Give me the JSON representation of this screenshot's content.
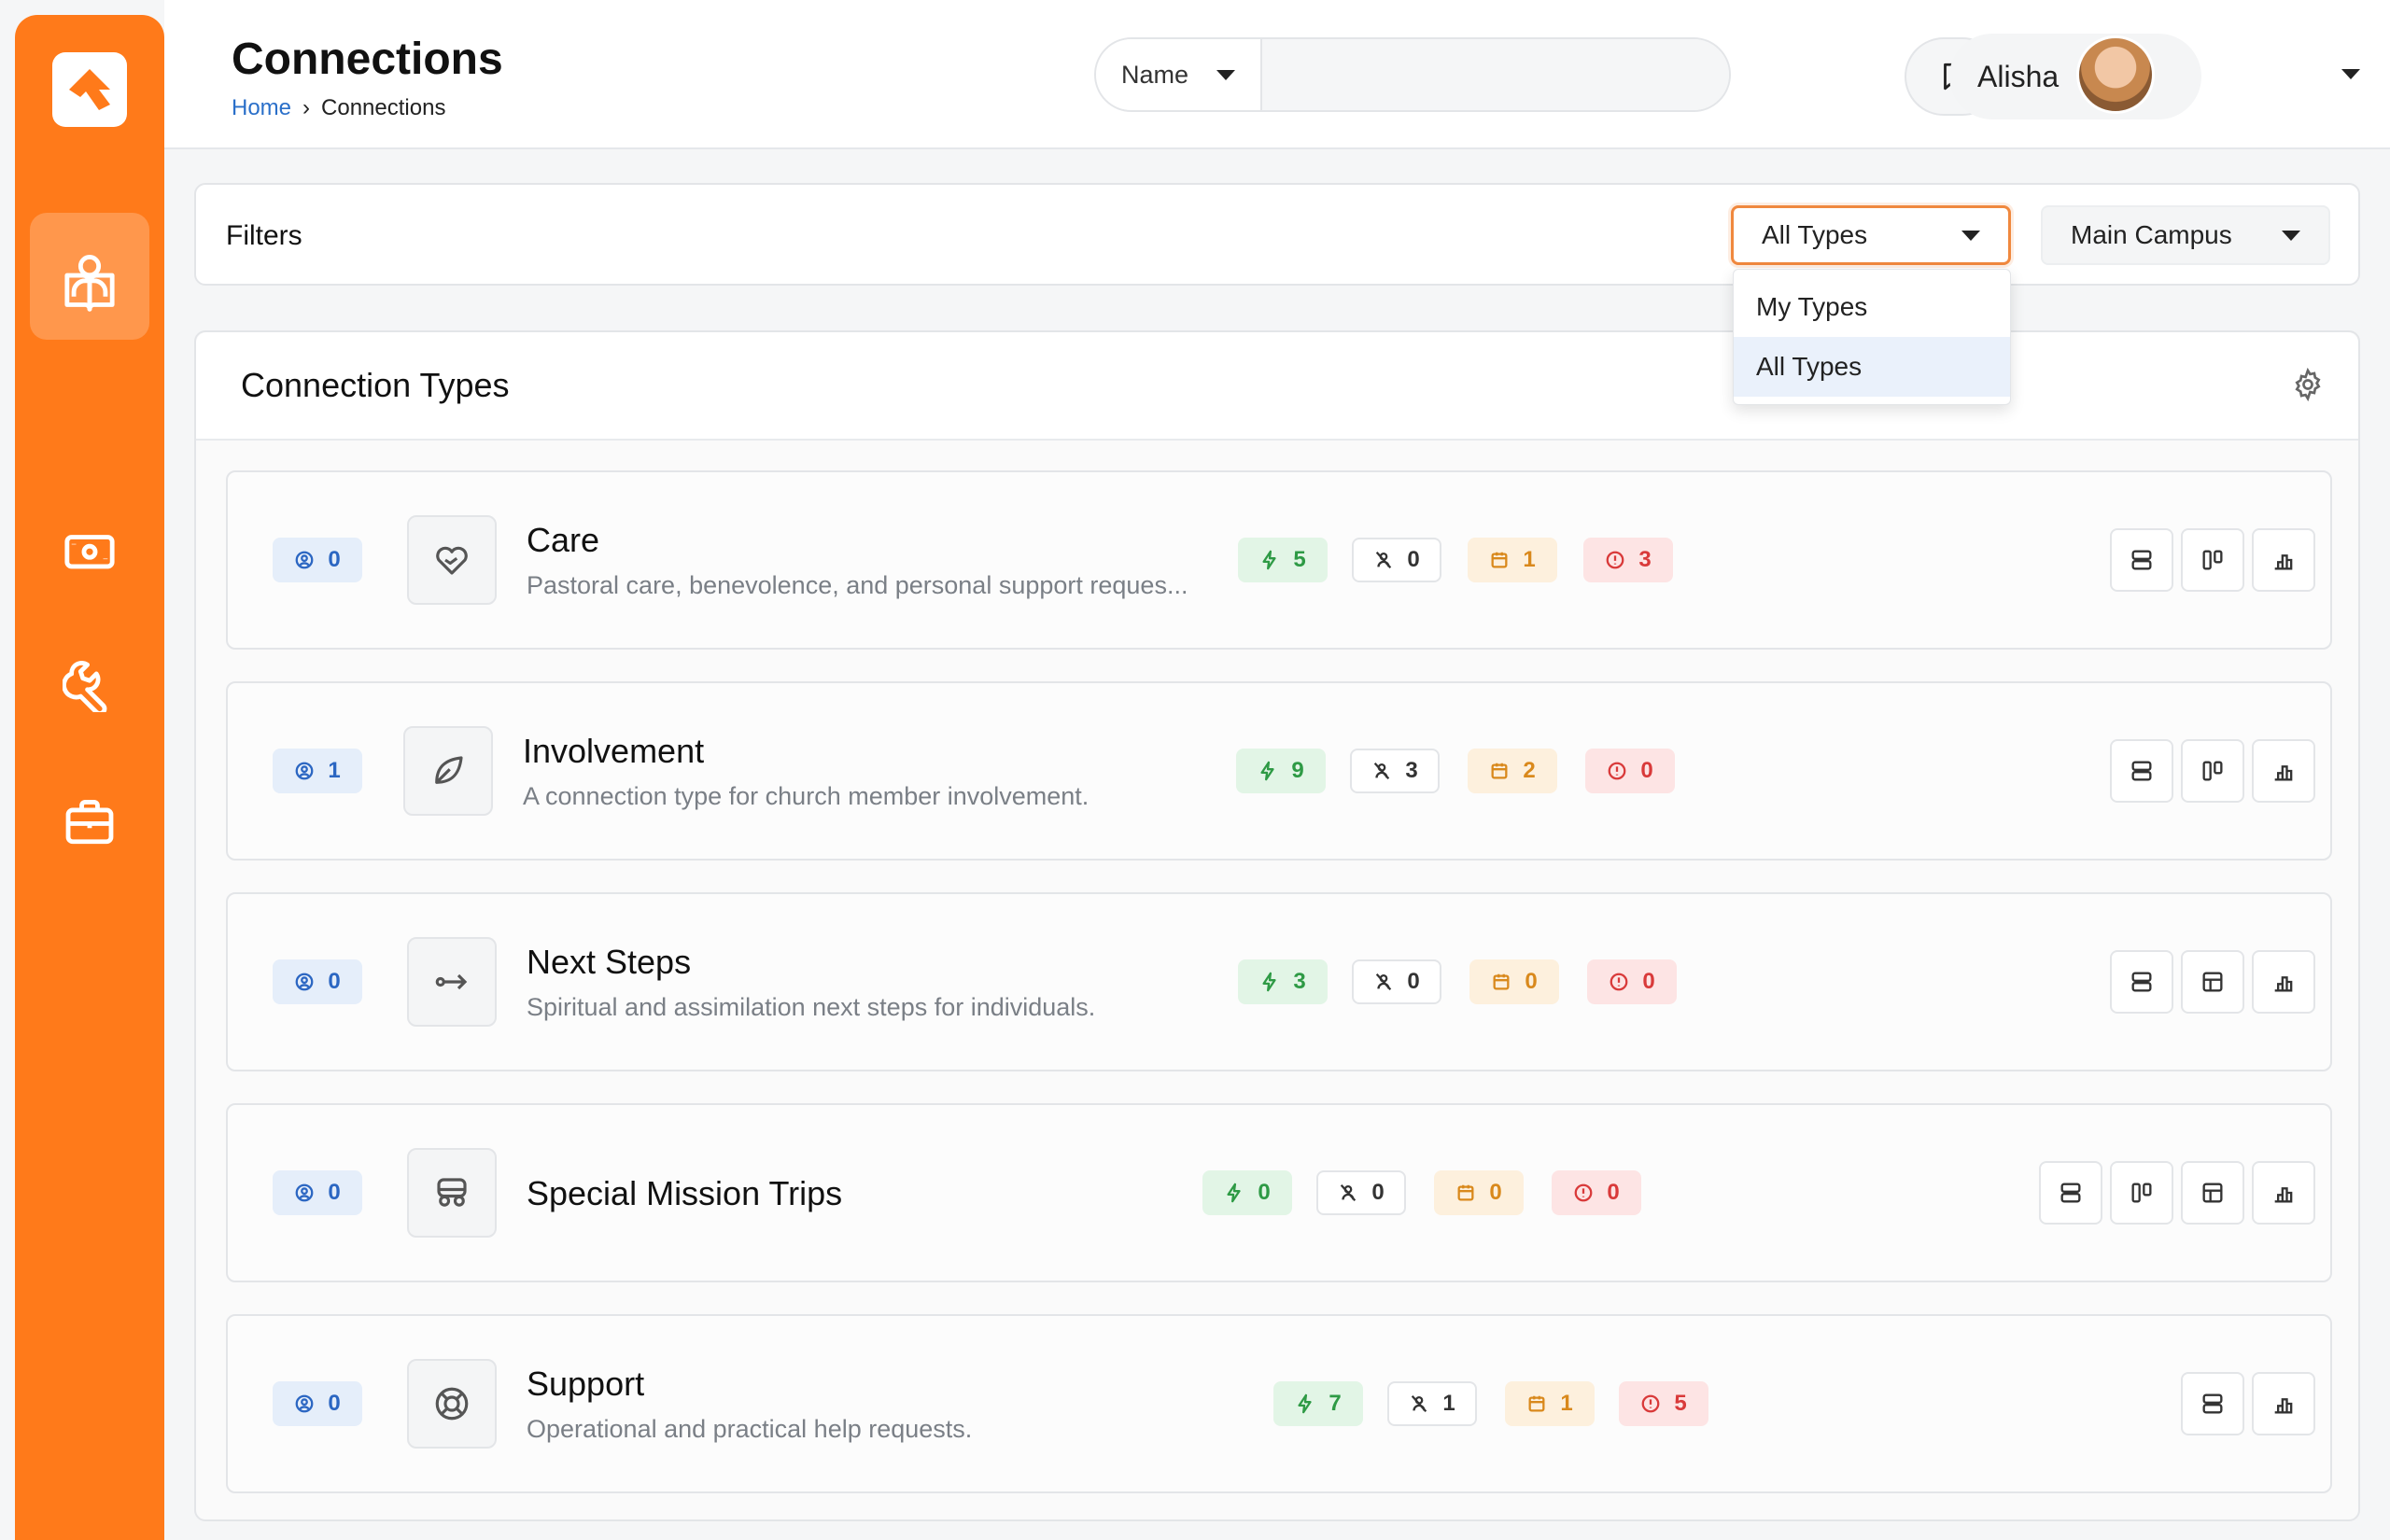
{
  "header": {
    "title": "Connections",
    "breadcrumb": {
      "home": "Home",
      "separator": "›",
      "current": "Connections"
    },
    "search": {
      "select_label": "Name",
      "placeholder": "",
      "value": ""
    },
    "user": {
      "name": "Alisha"
    }
  },
  "sidebar": {
    "items": [
      {
        "icon": "book-icon"
      },
      {
        "icon": "person-icon",
        "active": true
      },
      {
        "icon": "cash-icon"
      },
      {
        "icon": "wrench-icon"
      },
      {
        "icon": "briefcase-icon"
      }
    ]
  },
  "filters": {
    "label": "Filters",
    "type_select": "All Types",
    "campus_select": "Main Campus",
    "dropdown_options": [
      "My Types",
      "All Types"
    ]
  },
  "panel": {
    "title": "Connection Types"
  },
  "connection_types": [
    {
      "name": "Care",
      "description": "Pastoral care, benevolence, and personal support reques...",
      "assigned": "0",
      "active": "5",
      "unassigned": "0",
      "scheduled": "1",
      "critical": "3"
    },
    {
      "name": "Involvement",
      "description": "A connection type for church member involvement.",
      "assigned": "1",
      "active": "9",
      "unassigned": "3",
      "scheduled": "2",
      "critical": "0"
    },
    {
      "name": "Next Steps",
      "description": "Spiritual and assimilation next steps for individuals.",
      "assigned": "0",
      "active": "3",
      "unassigned": "0",
      "scheduled": "0",
      "critical": "0"
    },
    {
      "name": "Special Mission Trips",
      "description": "",
      "assigned": "0",
      "active": "0",
      "unassigned": "0",
      "scheduled": "0",
      "critical": "0"
    },
    {
      "name": "Support",
      "description": "Operational and practical help requests.",
      "assigned": "0",
      "active": "7",
      "unassigned": "1",
      "scheduled": "1",
      "critical": "5"
    }
  ],
  "colors": {
    "brand": "#ff7a1a",
    "blue": "#2b66c2",
    "green": "#2e9a45",
    "orange": "#d9891c",
    "red": "#d93a3a"
  }
}
